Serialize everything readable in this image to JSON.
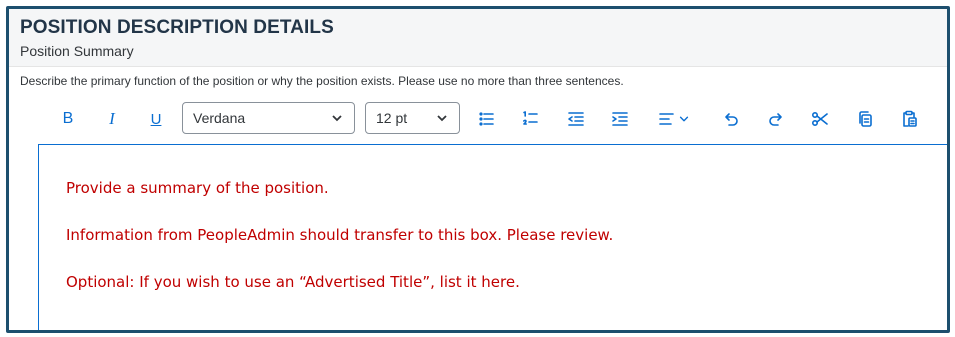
{
  "header": {
    "title": "POSITION DESCRIPTION DETAILS",
    "subtitle": "Position Summary"
  },
  "description": "Describe the primary function of the position or why the position exists. Please use no more than three sentences.",
  "toolbar": {
    "bold_label": "B",
    "italic_label": "I",
    "underline_label": "U",
    "font_family": "Verdana",
    "font_size": "12 pt"
  },
  "editor": {
    "lines": [
      "Provide a summary of the position.",
      "Information from PeopleAdmin should transfer to this box. Please review.",
      "Optional: If you wish to use an “Advertised Title”, list it here."
    ]
  },
  "colors": {
    "frame_border": "#1d4f6e",
    "accent": "#0a6ed1",
    "editor_text": "#c00000"
  }
}
